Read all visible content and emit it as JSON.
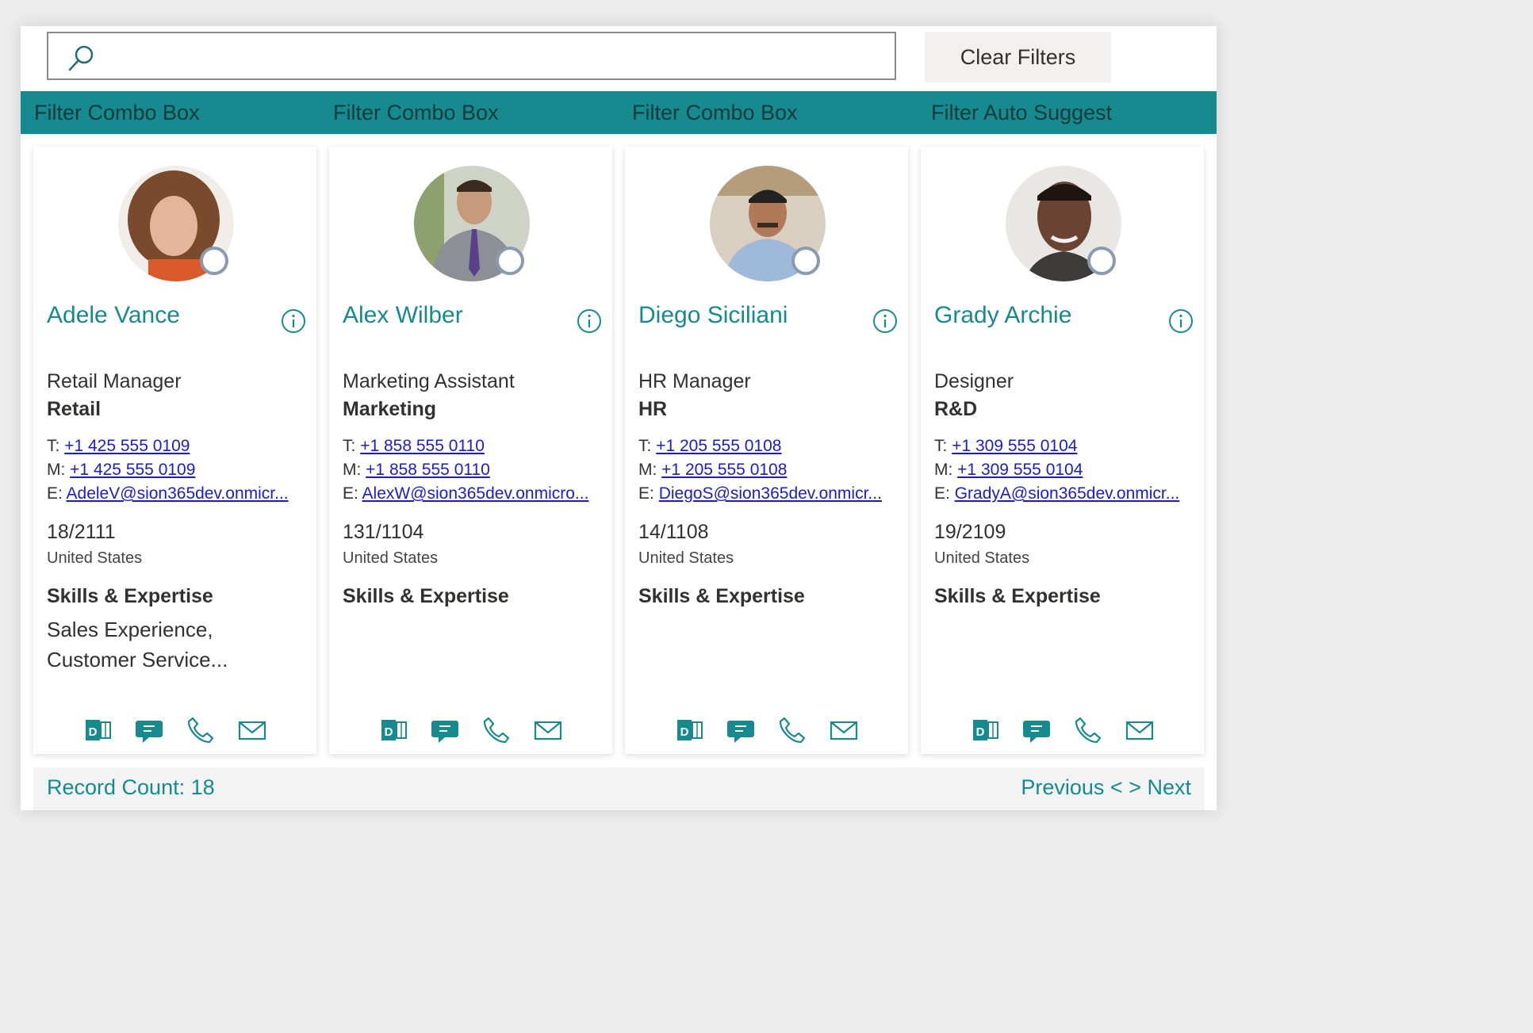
{
  "search": {
    "value": "",
    "placeholder": ""
  },
  "toolbar": {
    "clear_label": "Clear Filters"
  },
  "filters": [
    {
      "label": "Filter Combo Box"
    },
    {
      "label": "Filter Combo Box"
    },
    {
      "label": "Filter Combo Box"
    },
    {
      "label": "Filter Auto Suggest"
    }
  ],
  "cards": [
    {
      "name": "Adele Vance",
      "job": "Retail Manager",
      "dept": "Retail",
      "phone_label": "T:",
      "phone": "+1 425 555 0109",
      "mobile_label": "M:",
      "mobile": "+1 425 555 0109",
      "email_label": "E:",
      "email": "AdeleV@sion365dev.onmicr...",
      "office": "18/2111",
      "country": "United States",
      "skills_heading": "Skills & Expertise",
      "skills": "Sales Experience, Customer Service..."
    },
    {
      "name": "Alex Wilber",
      "job": "Marketing Assistant",
      "dept": "Marketing",
      "phone_label": "T:",
      "phone": "+1 858 555 0110",
      "mobile_label": "M:",
      "mobile": "+1 858 555 0110",
      "email_label": "E:",
      "email": "AlexW@sion365dev.onmicro...",
      "office": "131/1104",
      "country": "United States",
      "skills_heading": "Skills & Expertise",
      "skills": ""
    },
    {
      "name": "Diego Siciliani",
      "job": "HR Manager",
      "dept": "HR",
      "phone_label": "T:",
      "phone": "+1 205 555 0108",
      "mobile_label": "M:",
      "mobile": "+1 205 555 0108",
      "email_label": "E:",
      "email": "DiegoS@sion365dev.onmicr...",
      "office": "14/1108",
      "country": "United States",
      "skills_heading": "Skills & Expertise",
      "skills": ""
    },
    {
      "name": "Grady Archie",
      "job": "Designer",
      "dept": "R&D",
      "phone_label": "T:",
      "phone": "+1 309 555 0104",
      "mobile_label": "M:",
      "mobile": "+1 309 555 0104",
      "email_label": "E:",
      "email": "GradyA@sion365dev.onmicr...",
      "office": "19/2109",
      "country": "United States",
      "skills_heading": "Skills & Expertise",
      "skills": ""
    }
  ],
  "footer": {
    "record_count": "Record Count: 18",
    "previous": "Previous <",
    "next": "> Next"
  },
  "colors": {
    "accent": "#168a8f",
    "link": "#1b1bd6",
    "filter_text": "#0e3b3d"
  },
  "icons": [
    "search-icon",
    "info-icon",
    "delve-icon",
    "chat-icon",
    "phone-icon",
    "mail-icon",
    "presence-icon"
  ]
}
